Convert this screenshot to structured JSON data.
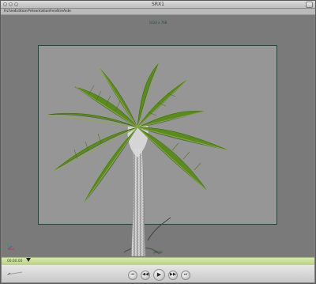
{
  "window": {
    "title": "SRX1"
  },
  "menubar": {
    "items": [
      "Fichier",
      "Edition",
      "Présentation",
      "Fenêtre",
      "Aide"
    ]
  },
  "viewport": {
    "resolution": "1024 x 768",
    "camera": "persp"
  },
  "playback": {
    "timecode": "00:00:00"
  },
  "controls": {
    "go_start_icon": "⏮",
    "step_back_icon": "◀◀",
    "play_icon": "▶",
    "step_forward_icon": "▶▶",
    "go_end_icon": "⏭"
  },
  "colors": {
    "titlebar": "#d2d2d2",
    "menubar": "#bababa",
    "gate_border": "#1a4a40",
    "timeline": "#c9dd98",
    "frond": "#6f9a27"
  }
}
